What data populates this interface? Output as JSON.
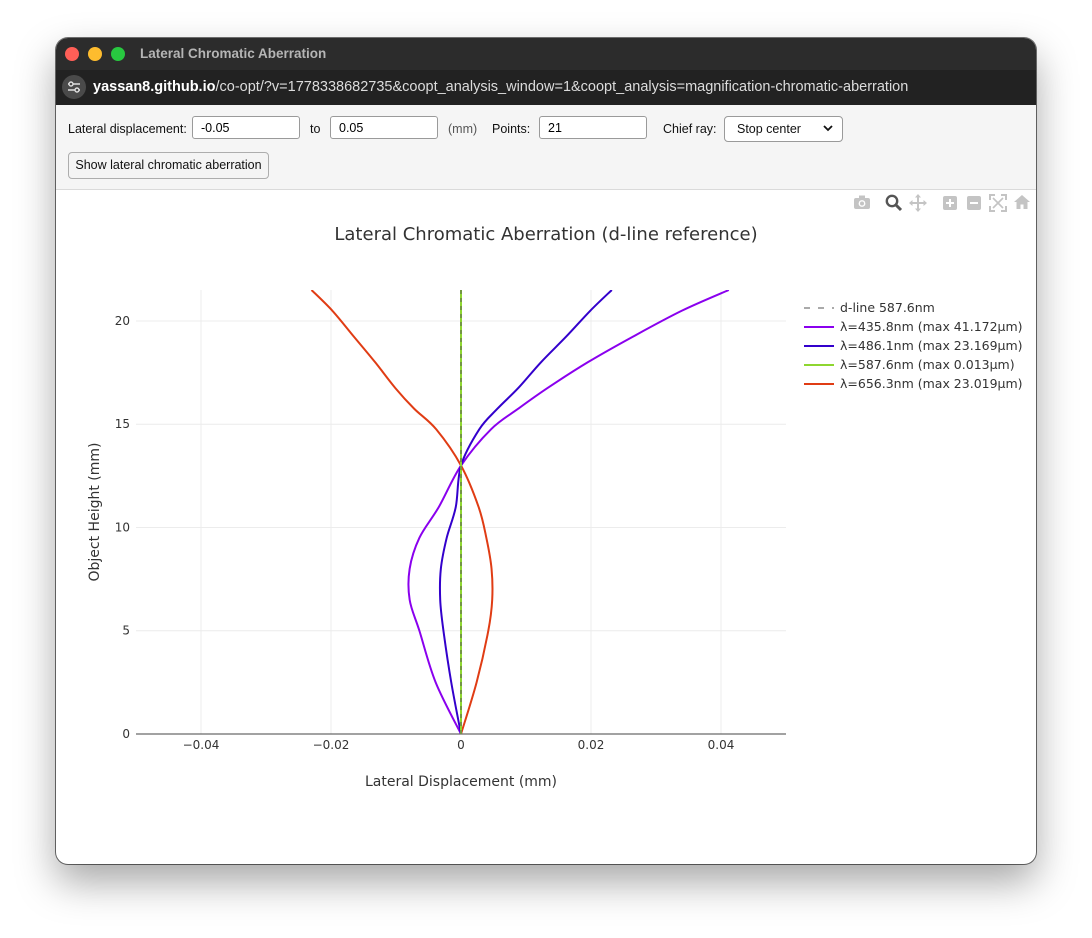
{
  "window": {
    "title": "Lateral Chromatic Aberration"
  },
  "urlbar": {
    "host": "yassan8.github.io",
    "path": "/co-opt/?v=1778338682735&coopt_analysis_window=1&coopt_analysis=magnification-chromatic-aberration"
  },
  "controls": {
    "lateral_label": "Lateral displacement:",
    "from_value": "-0.05",
    "to_label": "to",
    "to_value": "0.05",
    "unit_label": "(mm)",
    "points_label": "Points:",
    "points_value": "21",
    "chief_ray_label": "Chief ray:",
    "chief_ray_selected": "Stop center",
    "show_button": "Show lateral chromatic aberration"
  },
  "modebar": [
    "camera-icon",
    "zoom-icon",
    "pan-icon",
    "zoom-in-icon",
    "zoom-out-icon",
    "autoscale-icon",
    "reset-axes-icon"
  ],
  "chart_data": {
    "type": "line",
    "title": "Lateral Chromatic Aberration (d-line reference)",
    "xlabel": "Lateral Displacement (mm)",
    "ylabel": "Object Height (mm)",
    "xlim": [
      -0.05,
      0.05
    ],
    "ylim": [
      0,
      21.5
    ],
    "xticks": [
      -0.04,
      -0.02,
      0,
      0.02,
      0.04
    ],
    "xtick_labels": [
      "−0.04",
      "−0.02",
      "0",
      "0.02",
      "0.04"
    ],
    "yticks": [
      0,
      5,
      10,
      15,
      20
    ],
    "ytick_labels": [
      "0",
      "5",
      "10",
      "15",
      "20"
    ],
    "grid": true,
    "legend_position": "right",
    "series": [
      {
        "name": "d-line 587.6nm",
        "color": "#555555",
        "dash": true,
        "x": [
          0,
          0
        ],
        "y": [
          0,
          21.5
        ]
      },
      {
        "name": "λ=435.8nm (max 41.172μm)",
        "color": "#8a00ee",
        "x": [
          0,
          -0.0039,
          -0.0064,
          -0.0079,
          -0.0079,
          -0.0064,
          -0.0034,
          0,
          0.0046,
          0.0088,
          0.0133,
          0.0195,
          0.0265,
          0.034,
          0.0412
        ],
        "y": [
          0,
          2.5,
          5,
          6.5,
          8,
          9.5,
          11,
          13,
          14.75,
          15.75,
          16.75,
          18,
          19.25,
          20.5,
          21.5
        ]
      },
      {
        "name": "λ=486.1nm (max 23.169μm)",
        "color": "#3300cc",
        "x": [
          0,
          -0.0015,
          -0.0027,
          -0.0032,
          -0.0031,
          -0.0022,
          -0.0008,
          0,
          0.0028,
          0.0056,
          0.0088,
          0.0123,
          0.0162,
          0.0199,
          0.0232
        ],
        "y": [
          0,
          2.5,
          5,
          6.5,
          8,
          9.5,
          11,
          13,
          14.75,
          15.75,
          16.75,
          18,
          19.25,
          20.5,
          21.5
        ]
      },
      {
        "name": "λ=587.6nm (max 0.013μm)",
        "color": "#8ed630",
        "x": [
          0,
          0
        ],
        "y": [
          0,
          21.5
        ]
      },
      {
        "name": "λ=656.3nm (max 23.019μm)",
        "color": "#e03c14",
        "x": [
          0,
          0.0024,
          0.0042,
          0.0048,
          0.0047,
          0.0039,
          0.0027,
          0,
          -0.0038,
          -0.0072,
          -0.0101,
          -0.0132,
          -0.0165,
          -0.0198,
          -0.023
        ],
        "y": [
          0,
          2.5,
          5,
          6.5,
          8,
          9.5,
          11,
          13,
          14.75,
          15.75,
          16.75,
          18,
          19.25,
          20.5,
          21.5
        ]
      }
    ]
  }
}
